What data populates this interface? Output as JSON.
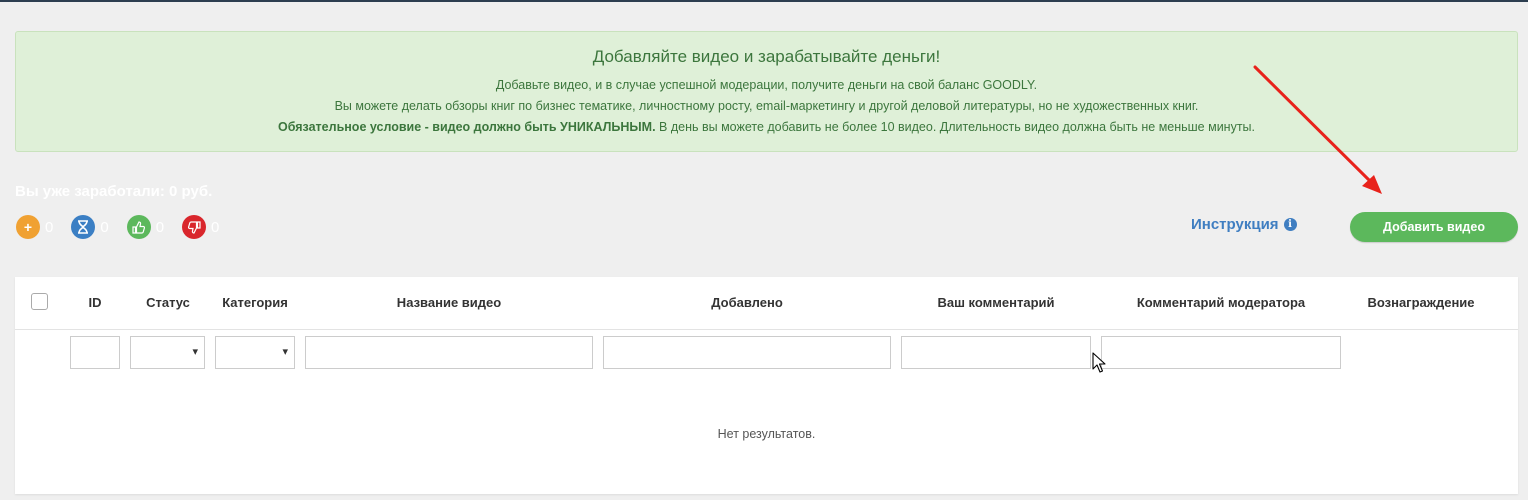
{
  "notice": {
    "title": "Добавляйте видео и зарабатывайте деньги!",
    "line1": "Добавьте видео, и в случае успешной модерации, получите деньги на свой баланс GOODLY.",
    "line2": "Вы можете делать обзоры книг по бизнес тематике, личностному росту, email-маркетингу и другой деловой литературы, но не художественных книг.",
    "line3_bold": "Обязательное условие - видео должно быть УНИКАЛЬНЫМ.",
    "line3_rest": " В день вы можете добавить не более 10 видео. Длительность видео должна быть не меньше минуты."
  },
  "earned": "Вы уже заработали: 0 руб.",
  "stats": [
    {
      "icon": "plus-icon",
      "symbol": "+",
      "count": "0",
      "color": "#f0a132"
    },
    {
      "icon": "hourglass-icon",
      "symbol": "⌛",
      "count": "0",
      "color": "#3b7fc4"
    },
    {
      "icon": "thumbs-up-icon",
      "symbol": "👍",
      "count": "0",
      "color": "#5cb85c"
    },
    {
      "icon": "thumbs-down-icon",
      "symbol": "👎",
      "count": "0",
      "color": "#d9262c"
    }
  ],
  "instruction": {
    "label": "Инструкция",
    "icon": "info-icon",
    "symbol": "i"
  },
  "add_button": {
    "label": "Добавить видео",
    "color": "#5cb85c"
  },
  "table": {
    "columns": [
      {
        "key": "id",
        "label": "ID"
      },
      {
        "key": "status",
        "label": "Статус"
      },
      {
        "key": "category",
        "label": "Категория"
      },
      {
        "key": "name",
        "label": "Название видео"
      },
      {
        "key": "added",
        "label": "Добавлено"
      },
      {
        "key": "your_comment",
        "label": "Ваш комментарий"
      },
      {
        "key": "mod_comment",
        "label": "Комментарий модератора"
      },
      {
        "key": "reward",
        "label": "Вознаграждение"
      }
    ],
    "empty_text": "Нет результатов."
  }
}
